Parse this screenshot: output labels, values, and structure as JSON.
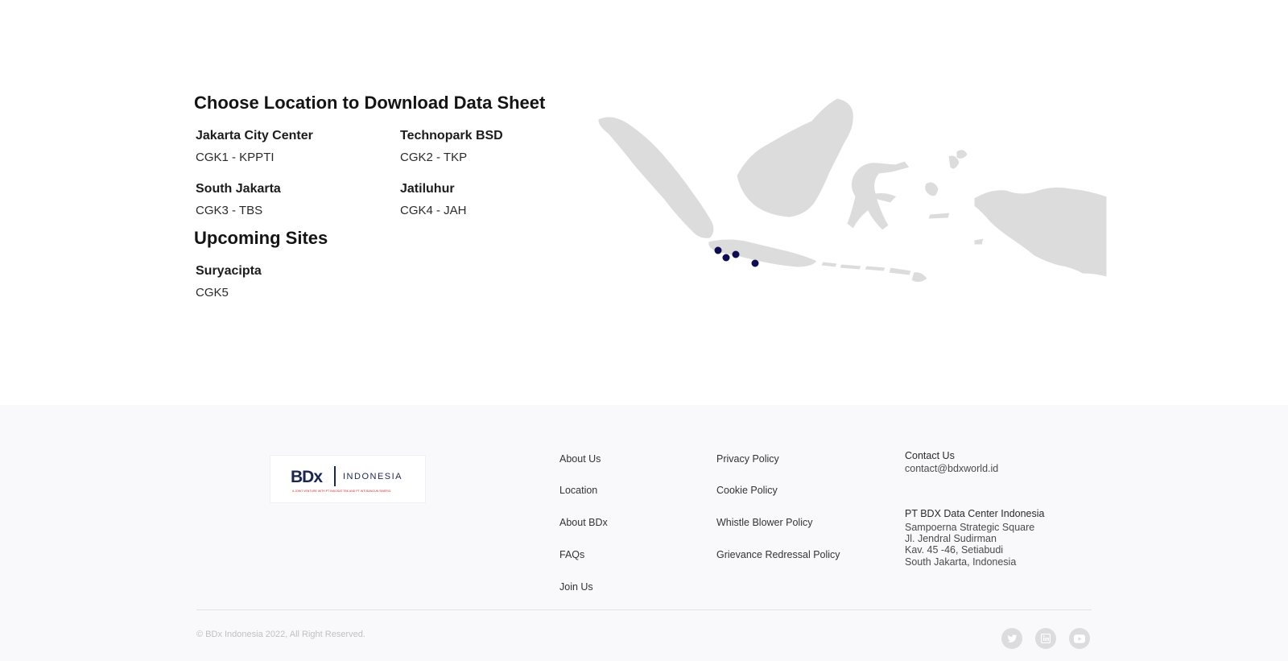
{
  "main": {
    "heading": "Choose Location to Download Data Sheet",
    "locations": [
      {
        "name": "Jakarta City Center",
        "code": "CGK1 - KPPTI"
      },
      {
        "name": "Technopark BSD",
        "code": "CGK2 - TKP"
      },
      {
        "name": "South Jakarta",
        "code": "CGK3 - TBS"
      },
      {
        "name": "Jatiluhur",
        "code": "CGK4 - JAH"
      }
    ],
    "upcoming_heading": "Upcoming Sites",
    "upcoming": [
      {
        "name": "Suryacipta",
        "code": "CGK5"
      }
    ],
    "map": {
      "land_color": "#dcdcdc",
      "marker_color": "#0d0d4f",
      "marker_count": 4
    }
  },
  "footer": {
    "logo": {
      "brand": "BDx",
      "country": "INDONESIA",
      "tagline": "A JOINT VENTURE WITH PT INDOSAT TBK AND PT INTI BANGUN SINERGI"
    },
    "links_col1": [
      "About Us",
      "Location",
      "About BDx",
      "FAQs",
      "Join Us"
    ],
    "links_col2": [
      "Privacy Policy",
      "Cookie Policy",
      "Whistle Blower Policy",
      "Grievance Redressal Policy"
    ],
    "contact": {
      "label": "Contact Us",
      "email": "contact@bdxworld.id",
      "company": "PT BDX Data Center Indonesia",
      "address": [
        "Sampoerna Strategic Square",
        "Jl. Jendral Sudirman",
        "Kav. 45 -46, Setiabudi",
        "South Jakarta, Indonesia"
      ]
    },
    "copyright": "© BDx Indonesia 2022, All Right Reserved.",
    "social": [
      {
        "icon": "twitter-icon"
      },
      {
        "icon": "linkedin-icon"
      },
      {
        "icon": "youtube-icon"
      }
    ]
  }
}
